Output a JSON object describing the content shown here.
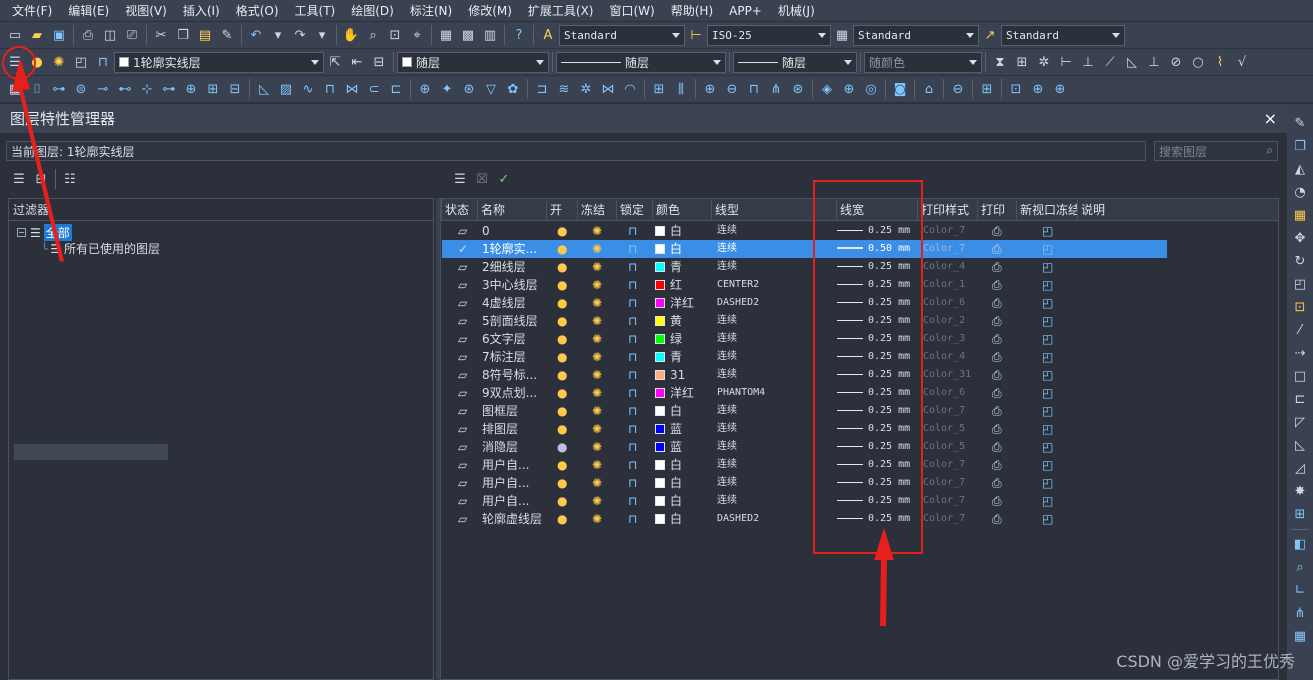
{
  "menu": [
    "文件(F)",
    "编辑(E)",
    "视图(V)",
    "插入(I)",
    "格式(O)",
    "工具(T)",
    "绘图(D)",
    "标注(N)",
    "修改(M)",
    "扩展工具(X)",
    "窗口(W)",
    "帮助(H)",
    "APP+",
    "机械(J)"
  ],
  "toolbar1": {
    "text_style": "Standard",
    "dim_style": "ISO-25",
    "table_style": "Standard",
    "multileader_style": "Standard"
  },
  "toolbar2": {
    "layer_combo": "1轮廓实线层",
    "color_combo": "随层",
    "linetype_combo": "随层",
    "lineweight_combo": "随层",
    "plotstyle_combo": "随颜色"
  },
  "palette": {
    "title": "图层特性管理器",
    "current_layer_label": "当前图层: 1轮廓实线层",
    "search_placeholder": "搜索图层",
    "close_glyph": "×"
  },
  "filter_pane": {
    "header": "过滤器",
    "tree": [
      {
        "label": "全部",
        "selected": true
      },
      {
        "label": "所有已使用的图层",
        "selected": false
      }
    ]
  },
  "layer_table": {
    "columns": [
      "状态",
      "名称",
      "开",
      "冻结",
      "锁定",
      "颜色",
      "线型",
      "线宽",
      "打印样式",
      "打印",
      "新视口冻结",
      "说明"
    ],
    "rows": [
      {
        "name": "0",
        "color_name": "白",
        "color_hex": "#ffffff",
        "linetype": "连续",
        "lineweight": "0.25 mm",
        "plot_style": "Color_7",
        "on": true,
        "current": false
      },
      {
        "name": "1轮廓实...",
        "color_name": "白",
        "color_hex": "#ffffff",
        "linetype": "连续",
        "lineweight": "0.50 mm",
        "plot_style": "Color_7",
        "on": true,
        "current": true
      },
      {
        "name": "2细线层",
        "color_name": "青",
        "color_hex": "#00ffff",
        "linetype": "连续",
        "lineweight": "0.25 mm",
        "plot_style": "Color_4",
        "on": true,
        "current": false
      },
      {
        "name": "3中心线层",
        "color_name": "红",
        "color_hex": "#ff0000",
        "linetype": "CENTER2",
        "lineweight": "0.25 mm",
        "plot_style": "Color_1",
        "on": true,
        "current": false
      },
      {
        "name": "4虚线层",
        "color_name": "洋红",
        "color_hex": "#ff00ff",
        "linetype": "DASHED2",
        "lineweight": "0.25 mm",
        "plot_style": "Color_6",
        "on": true,
        "current": false
      },
      {
        "name": "5剖面线层",
        "color_name": "黄",
        "color_hex": "#ffff00",
        "linetype": "连续",
        "lineweight": "0.25 mm",
        "plot_style": "Color_2",
        "on": true,
        "current": false
      },
      {
        "name": "6文字层",
        "color_name": "绿",
        "color_hex": "#00ff00",
        "linetype": "连续",
        "lineweight": "0.25 mm",
        "plot_style": "Color_3",
        "on": true,
        "current": false
      },
      {
        "name": "7标注层",
        "color_name": "青",
        "color_hex": "#00ffff",
        "linetype": "连续",
        "lineweight": "0.25 mm",
        "plot_style": "Color_4",
        "on": true,
        "current": false
      },
      {
        "name": "8符号标...",
        "color_name": "31",
        "color_hex": "#ffaa7f",
        "linetype": "连续",
        "lineweight": "0.25 mm",
        "plot_style": "Color_31",
        "on": true,
        "current": false
      },
      {
        "name": "9双点划...",
        "color_name": "洋红",
        "color_hex": "#ff00ff",
        "linetype": "PHANTOM4",
        "lineweight": "0.25 mm",
        "plot_style": "Color_6",
        "on": true,
        "current": false
      },
      {
        "name": "图框层",
        "color_name": "白",
        "color_hex": "#ffffff",
        "linetype": "连续",
        "lineweight": "0.25 mm",
        "plot_style": "Color_7",
        "on": true,
        "current": false
      },
      {
        "name": "排图层",
        "color_name": "蓝",
        "color_hex": "#0000ff",
        "linetype": "连续",
        "lineweight": "0.25 mm",
        "plot_style": "Color_5",
        "on": true,
        "current": false
      },
      {
        "name": "消隐层",
        "color_name": "蓝",
        "color_hex": "#0000ff",
        "linetype": "连续",
        "lineweight": "0.25 mm",
        "plot_style": "Color_5",
        "on": false,
        "current": false
      },
      {
        "name": "用户自...",
        "color_name": "白",
        "color_hex": "#ffffff",
        "linetype": "连续",
        "lineweight": "0.25 mm",
        "plot_style": "Color_7",
        "on": true,
        "current": false
      },
      {
        "name": "用户自...",
        "color_name": "白",
        "color_hex": "#ffffff",
        "linetype": "连续",
        "lineweight": "0.25 mm",
        "plot_style": "Color_7",
        "on": true,
        "current": false
      },
      {
        "name": "用户自...",
        "color_name": "白",
        "color_hex": "#ffffff",
        "linetype": "连续",
        "lineweight": "0.25 mm",
        "plot_style": "Color_7",
        "on": true,
        "current": false
      },
      {
        "name": "轮廓虚线层",
        "color_name": "白",
        "color_hex": "#ffffff",
        "linetype": "DASHED2",
        "lineweight": "0.25 mm",
        "plot_style": "Color_7",
        "on": true,
        "current": false
      }
    ]
  },
  "watermark": "CSDN @爱学习的王优秀",
  "colors": {
    "annotation_red": "#e8201b",
    "selection_blue": "#3a8ee6",
    "panel_bg": "#2b303a"
  }
}
